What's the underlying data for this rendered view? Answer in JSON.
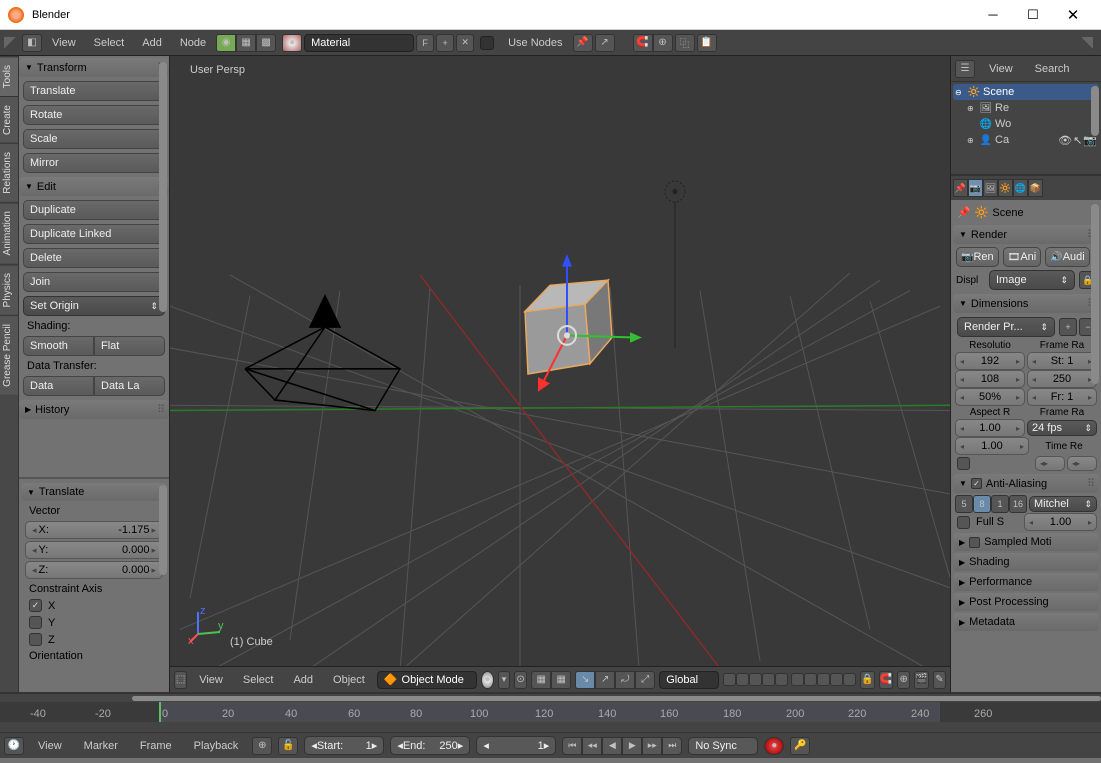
{
  "app": {
    "title": "Blender"
  },
  "header": {
    "menus": [
      "View",
      "Select",
      "Add",
      "Node"
    ],
    "material_field": "Material",
    "f_btn": "F",
    "use_nodes": "Use Nodes"
  },
  "left_tabs": [
    "Tools",
    "Create",
    "Relations",
    "Animation",
    "Physics",
    "Grease Pencil"
  ],
  "tools": {
    "transform": {
      "title": "Transform",
      "buttons": [
        "Translate",
        "Rotate",
        "Scale",
        "Mirror"
      ]
    },
    "edit": {
      "title": "Edit",
      "buttons": [
        "Duplicate",
        "Duplicate Linked",
        "Delete",
        "Join"
      ],
      "set_origin": "Set Origin",
      "shading_label": "Shading:",
      "smooth": "Smooth",
      "flat": "Flat",
      "data_transfer_label": "Data Transfer:",
      "data": "Data",
      "data_la": "Data La"
    },
    "history": {
      "title": "History"
    }
  },
  "operator": {
    "title": "Translate",
    "vector_label": "Vector",
    "x_label": "X:",
    "x_val": "-1.175",
    "y_label": "Y:",
    "y_val": "0.000",
    "z_label": "Z:",
    "z_val": "0.000",
    "constraint_label": "Constraint Axis",
    "cx": "X",
    "cy": "Y",
    "cz": "Z",
    "orientation_label": "Orientation"
  },
  "viewport": {
    "persp": "User Persp",
    "object": "(1) Cube",
    "footer_menus": [
      "View",
      "Select",
      "Add",
      "Object"
    ],
    "mode": "Object Mode",
    "orientation": "Global"
  },
  "outliner": {
    "menus": [
      "View",
      "Search"
    ],
    "scene": "Scene",
    "items": [
      "Re",
      "Wo",
      "Ca"
    ]
  },
  "properties": {
    "context": "Scene",
    "render": {
      "title": "Render",
      "render_btn": "Ren",
      "anim_btn": "Ani",
      "audio_btn": "Audi",
      "display_label": "Displ",
      "display_val": "Image"
    },
    "dimensions": {
      "title": "Dimensions",
      "preset": "Render Pr...",
      "res_label": "Resolutio",
      "fr_label": "Frame Ra",
      "resx": "192",
      "resy": "108",
      "respct": "50%",
      "fr_start": "St: 1",
      "fr_end": "250",
      "fr_step": "Fr: 1",
      "aspect_label": "Aspect R",
      "rate_label": "Frame Ra",
      "ax": "1.00",
      "ay": "1.00",
      "fps": "24 fps",
      "time_re": "Time Re"
    },
    "aa": {
      "title": "Anti-Aliasing",
      "samples": [
        "5",
        "8",
        "1",
        "16"
      ],
      "filter": "Mitchel",
      "full_s": "Full S",
      "size": "1.00"
    },
    "panels": [
      "Sampled Moti",
      "Shading",
      "Performance",
      "Post Processing",
      "Metadata"
    ]
  },
  "timeline": {
    "menus": [
      "View",
      "Marker",
      "Frame",
      "Playback"
    ],
    "start_label": "Start:",
    "start": "1",
    "end_label": "End:",
    "end": "250",
    "current": "1",
    "sync": "No Sync",
    "ticks": [
      "-40",
      "-20",
      "0",
      "20",
      "40",
      "60",
      "80",
      "100",
      "120",
      "140",
      "160",
      "180",
      "200",
      "220",
      "240",
      "260"
    ]
  }
}
